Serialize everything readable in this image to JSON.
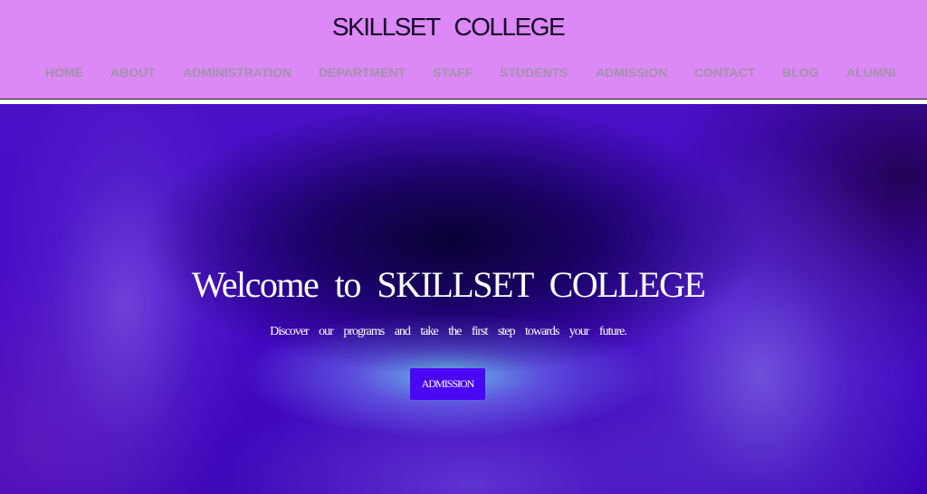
{
  "header": {
    "site_title": "SKILLSET COLLEGE",
    "background_color": "#dc88f6",
    "nav": [
      {
        "id": "home",
        "label": "HOME"
      },
      {
        "id": "about",
        "label": "ABOUT"
      },
      {
        "id": "administration",
        "label": "ADMINISTRATION"
      },
      {
        "id": "department",
        "label": "DEPARTMENT"
      },
      {
        "id": "staff",
        "label": "STAFF"
      },
      {
        "id": "students",
        "label": "STUDENTS"
      },
      {
        "id": "admission",
        "label": "ADMISSION"
      },
      {
        "id": "contact",
        "label": "CONTACT"
      },
      {
        "id": "blog",
        "label": "BLOG"
      },
      {
        "id": "alumni",
        "label": "ALUMNI"
      }
    ]
  },
  "hero": {
    "heading": "Welcome to SKILLSET COLLEGE",
    "subtitle": "Discover our programs and take the first step towards your future.",
    "button_label": "ADMISSION",
    "button_color": "#4a07f3"
  }
}
